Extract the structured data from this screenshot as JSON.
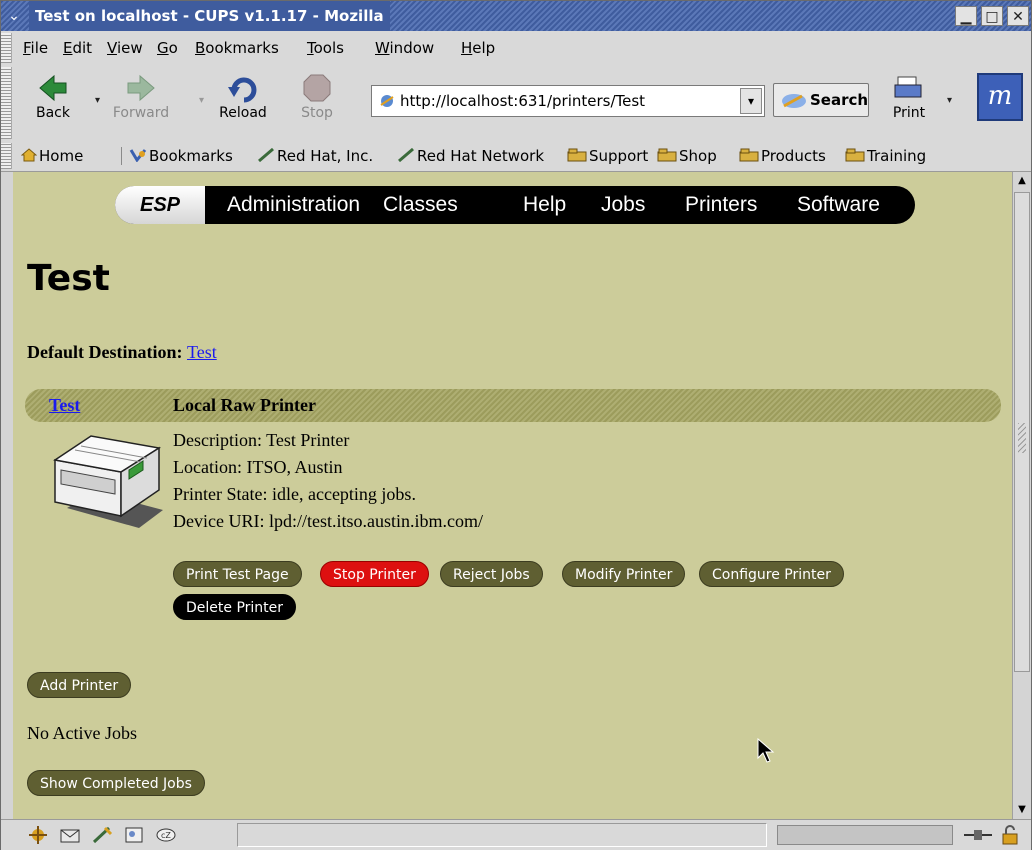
{
  "window": {
    "title": "Test on localhost - CUPS v1.1.17 - Mozilla",
    "system_menu_glyph": "⌄",
    "minimize_glyph": "▁",
    "maximize_glyph": "□",
    "close_glyph": "✕"
  },
  "menubar": {
    "items": [
      "File",
      "Edit",
      "View",
      "Go",
      "Bookmarks",
      "Tools",
      "Window",
      "Help"
    ]
  },
  "navbar": {
    "back_label": "Back",
    "forward_label": "Forward",
    "reload_label": "Reload",
    "stop_label": "Stop",
    "url": "http://localhost:631/printers/Test",
    "search_label": "Search",
    "print_label": "Print",
    "dropdown_glyph": "▾",
    "logo_glyph": "m"
  },
  "personal_toolbar": {
    "items": [
      "Home",
      "Bookmarks",
      "Red Hat, Inc.",
      "Red Hat Network",
      "Support",
      "Shop",
      "Products",
      "Training"
    ]
  },
  "esp_nav": {
    "brand": "ESP",
    "links": [
      "Administration",
      "Classes",
      "Help",
      "Jobs",
      "Printers",
      "Software"
    ]
  },
  "page": {
    "title": "Test",
    "default_destination_label": "Default Destination:",
    "default_destination_link": "Test",
    "printer_link": "Test",
    "printer_type": "Local Raw Printer",
    "description": "Description: Test Printer",
    "location": "Location: ITSO, Austin",
    "state": "Printer State: idle, accepting jobs.",
    "device_uri": "Device URI: lpd://test.itso.austin.ibm.com/",
    "buttons": {
      "print_test_page": "Print Test Page",
      "stop_printer": "Stop Printer",
      "reject_jobs": "Reject Jobs",
      "modify_printer": "Modify Printer",
      "configure_printer": "Configure Printer",
      "delete_printer": "Delete Printer",
      "add_printer": "Add Printer",
      "show_completed_jobs": "Show Completed Jobs"
    },
    "no_jobs": "No Active Jobs"
  },
  "scrollbar": {
    "up_glyph": "▲",
    "down_glyph": "▼"
  },
  "colors": {
    "page_background": "#cccc9a",
    "pill_button": "#5f5f32",
    "stop_button": "#dd1010",
    "delete_button": "#000000",
    "link": "#1a1aee",
    "title_bar": "#3f5c9e"
  }
}
